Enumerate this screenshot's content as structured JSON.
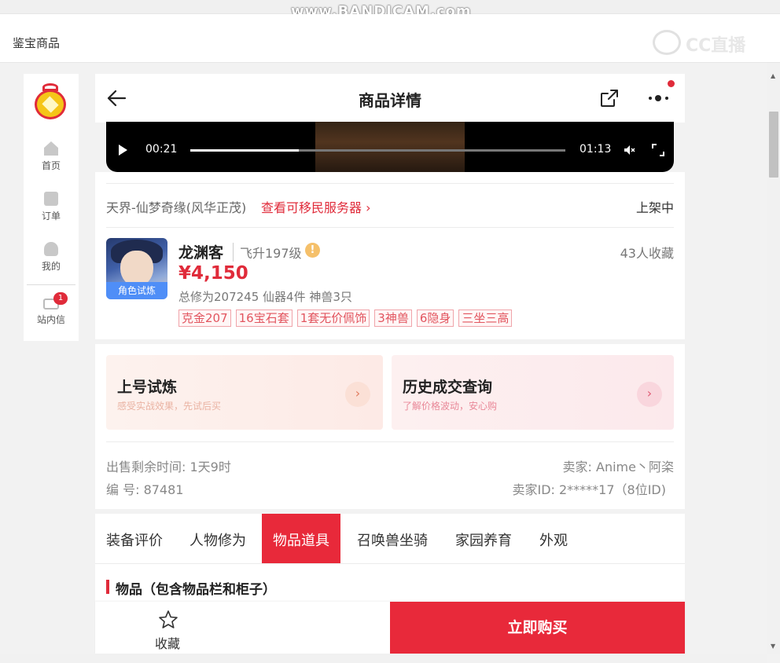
{
  "watermark": "www.BANDICAM.com",
  "header": {
    "title": "鉴宝商品",
    "cc_logo": "CC直播"
  },
  "sidebar": {
    "items": [
      {
        "label": "首页",
        "icon": "home-icon"
      },
      {
        "label": "订单",
        "icon": "order-icon"
      },
      {
        "label": "我的",
        "icon": "user-icon"
      },
      {
        "label": "站内信",
        "icon": "mail-icon",
        "badge": "1"
      }
    ]
  },
  "nav": {
    "title": "商品详情"
  },
  "video": {
    "current_time": "00:21",
    "total_time": "01:13",
    "progress": 0.29
  },
  "listing": {
    "server": "天界-仙梦奇缘(风华正茂)",
    "server_link": "查看可移民服务器",
    "status": "上架中",
    "avatar_tag": "角色试炼",
    "name": "龙渊客",
    "level": "飞升197级",
    "favorites": "43人收藏",
    "price": "¥4,150",
    "stats": "总修为207245  仙器4件  神兽3只",
    "tags": [
      "克金207",
      "16宝石套",
      "1套无价佩饰",
      "3神兽",
      "6隐身",
      "三坐三高"
    ]
  },
  "actions": {
    "trial": {
      "title": "上号试炼",
      "subtitle": "感受实战效果，先试后买"
    },
    "history": {
      "title": "历史成交查询",
      "subtitle": "了解价格波动，安心购"
    }
  },
  "meta": {
    "sale_time": "出售剩余时间: 1天9时",
    "seller": "卖家: Anime丶阿栥",
    "item_no": "编 号: 87481",
    "seller_id": "卖家ID: 2*****17（8位ID)"
  },
  "tabs": [
    "装备评价",
    "人物修为",
    "物品道具",
    "召唤兽坐骑",
    "家园养育",
    "外观"
  ],
  "active_tab": "物品道具",
  "section": {
    "title": "物品（包含物品栏和柜子）"
  },
  "bottom": {
    "favorite_label": "收藏",
    "buy_label": "立即购买"
  },
  "colors": {
    "accent": "#e8293a",
    "link": "#e02b3a",
    "tag_border": "#f0a4aa"
  }
}
